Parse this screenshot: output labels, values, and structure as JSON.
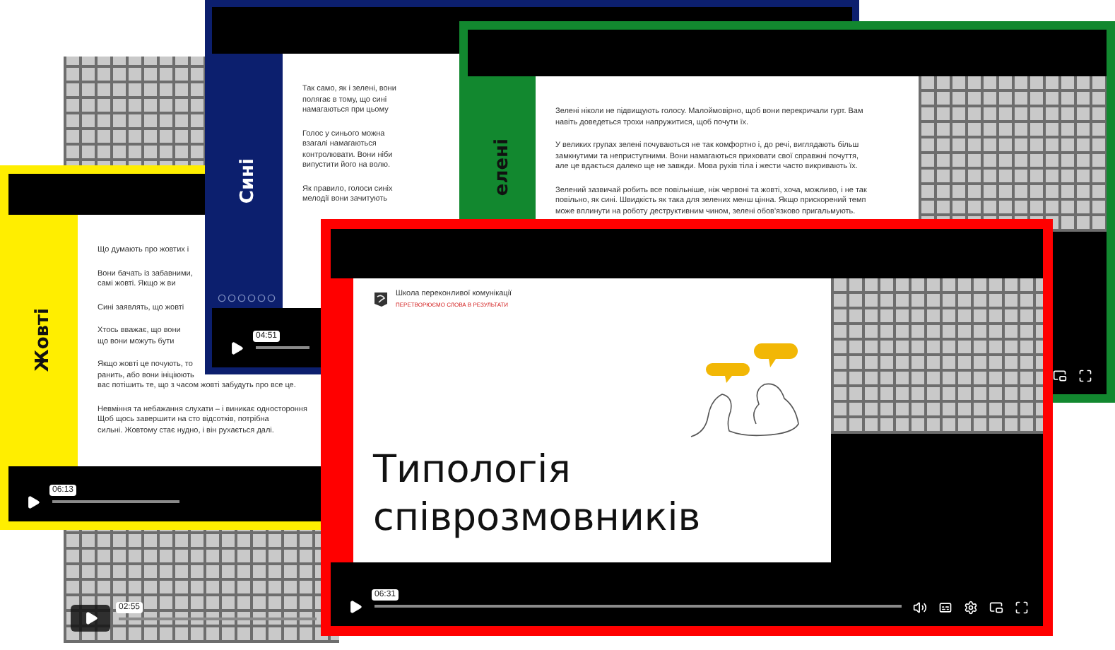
{
  "players": [
    {
      "kind": "tiles",
      "time": "02:55"
    },
    {
      "kind": "slide",
      "color": "#ffee00",
      "sidebar_label": "Жовті",
      "paragraphs": [
        [
          "Що думають про жовтих і"
        ],
        [
          "Вони бачать із забавними,",
          "самі жовті. Якщо ж ви"
        ],
        [
          "Сині заявлять, що жовті"
        ],
        [
          "Хтось вважає, що вони",
          "що вони можуть бути"
        ],
        [
          "Якщо жовті це почують, то",
          "ранить, або вони ініціюють",
          "вас потішить те, що з часом жовті забудуть про все це."
        ],
        [
          "Невміння та небажання слухати – і виникає одностороння",
          "Щоб щось завершити на сто відсотків, потрібна",
          "сильні. Жовтому стає нудно, і він рухається далі."
        ]
      ],
      "time": "06:13"
    },
    {
      "kind": "slide",
      "color": "#0c1f6e",
      "sidebar_label": "Сині",
      "paragraphs": [
        [
          "Так само, як і зелені, вони",
          "полягає в тому, що сині",
          "намагаються при цьому"
        ],
        [
          "Голос у синього можна",
          "взагалі намагаються",
          "контролювати. Вони ніби",
          "випустити його на волю."
        ],
        [
          "Як правило, голоси синіх",
          "мелодії вони зачитують"
        ]
      ],
      "time": "04:51"
    },
    {
      "kind": "speaker_slide",
      "color": "#12882f",
      "sidebar_label": "елені",
      "paragraphs": [
        [
          "Зелені ніколи не підвищують голосу. Малоймовірно, щоб вони перекричали гурт. Вам",
          "навіть доведеться трохи напружитися, щоб почути їх."
        ],
        [
          "У великих групах зелені почуваються не так комфортно і, до речі, виглядають більш",
          "замкнутими та неприступними. Вони намагаються приховати свої справжні почуття,",
          "але це вдається далеко ще не завжди. Мова рухів тіла і жести часто викривають їх."
        ],
        [
          "Зелений зазвичай робить все повільніше, ніж червоні та жовті, хоча, можливо, і не так",
          "повільно, як сині. Швидкість як така для зелених менш цінна. Якщо прискорений темп",
          "може вплинути на роботу деструктивним чином, зелені обов'язково пригальмують."
        ]
      ]
    },
    {
      "kind": "speaker_title",
      "color": "#ff0000",
      "school": "Школа переконливої комунікації",
      "tagline": "ПЕРЕТВОРЮЄМО СЛОВА В РЕЗУЛЬТАТИ",
      "title": "Типологія співрозмовників",
      "time": "06:31"
    }
  ]
}
